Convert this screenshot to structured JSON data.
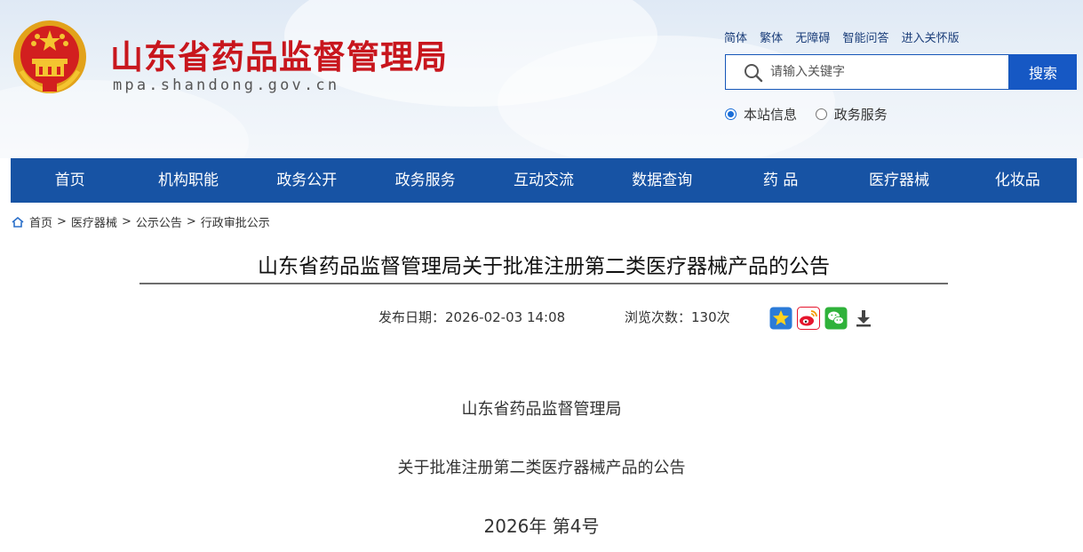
{
  "header": {
    "site_title": "山东省药品监督管理局",
    "site_domain": "mpa.shandong.gov.cn",
    "top_links": [
      "简体",
      "繁体",
      "无障碍",
      "智能问答",
      "进入关怀版"
    ],
    "search": {
      "placeholder": "请输入关键字",
      "button": "搜索"
    },
    "scope_options": [
      {
        "label": "本站信息",
        "checked": true
      },
      {
        "label": "政务服务",
        "checked": false
      }
    ],
    "brand_color": "#c8161d"
  },
  "nav": {
    "items": [
      "首页",
      "机构职能",
      "政务公开",
      "政务服务",
      "互动交流",
      "数据查询",
      "药 品",
      "医疗器械",
      "化妆品"
    ],
    "color": "#1753a4"
  },
  "breadcrumb": [
    "首页",
    "医疗器械",
    "公示公告",
    "行政审批公示"
  ],
  "article": {
    "title": "山东省药品监督管理局关于批准注册第二类医疗器械产品的公告",
    "publish_date": "发布日期：2026-02-03 14:08",
    "views": "浏览次数：130次",
    "share_icons": [
      "favorite-icon",
      "weibo-icon",
      "wechat-icon",
      "download-icon"
    ],
    "body_lines": [
      "山东省药品监督管理局",
      "关于批准注册第二类医疗器械产品的公告",
      "2026年  第4号"
    ]
  }
}
